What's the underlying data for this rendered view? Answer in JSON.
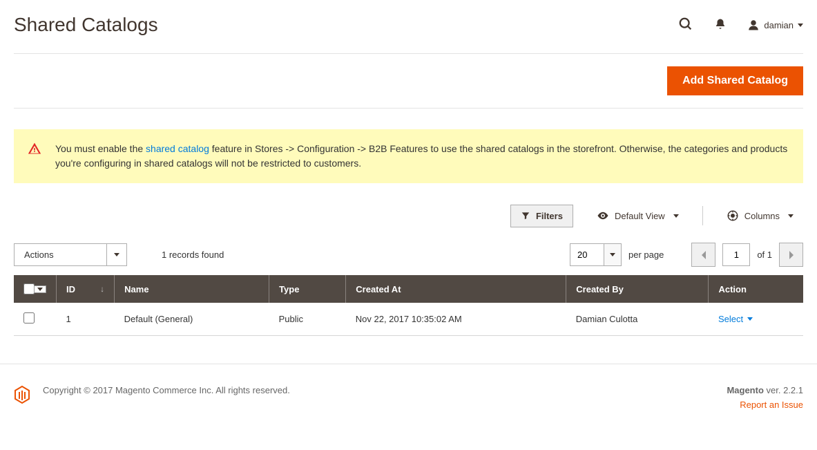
{
  "page_title": "Shared Catalogs",
  "user": {
    "name": "damian"
  },
  "primary_button": "Add Shared Catalog",
  "notice": {
    "pre": "You must enable the ",
    "link": "shared catalog",
    "post": " feature in Stores -> Configuration -> B2B Features to use the shared catalogs in the storefront. Otherwise, the categories and products you're configuring in shared catalogs will not be restricted to customers."
  },
  "controls": {
    "filters": "Filters",
    "default_view": "Default View",
    "columns": "Columns"
  },
  "grid": {
    "actions_label": "Actions",
    "records_found": "1 records found",
    "page_size": "20",
    "per_page": "per page",
    "page_num": "1",
    "of_pages": "of 1",
    "columns": [
      "ID",
      "Name",
      "Type",
      "Created At",
      "Created By",
      "Action"
    ],
    "rows": [
      {
        "id": "1",
        "name": "Default (General)",
        "type": "Public",
        "created_at": "Nov 22, 2017 10:35:02 AM",
        "created_by": "Damian Culotta",
        "action": "Select"
      }
    ]
  },
  "footer": {
    "copyright": "Copyright © 2017 Magento Commerce Inc. All rights reserved.",
    "brand": "Magento",
    "version": " ver. 2.2.1",
    "report": "Report an Issue"
  }
}
